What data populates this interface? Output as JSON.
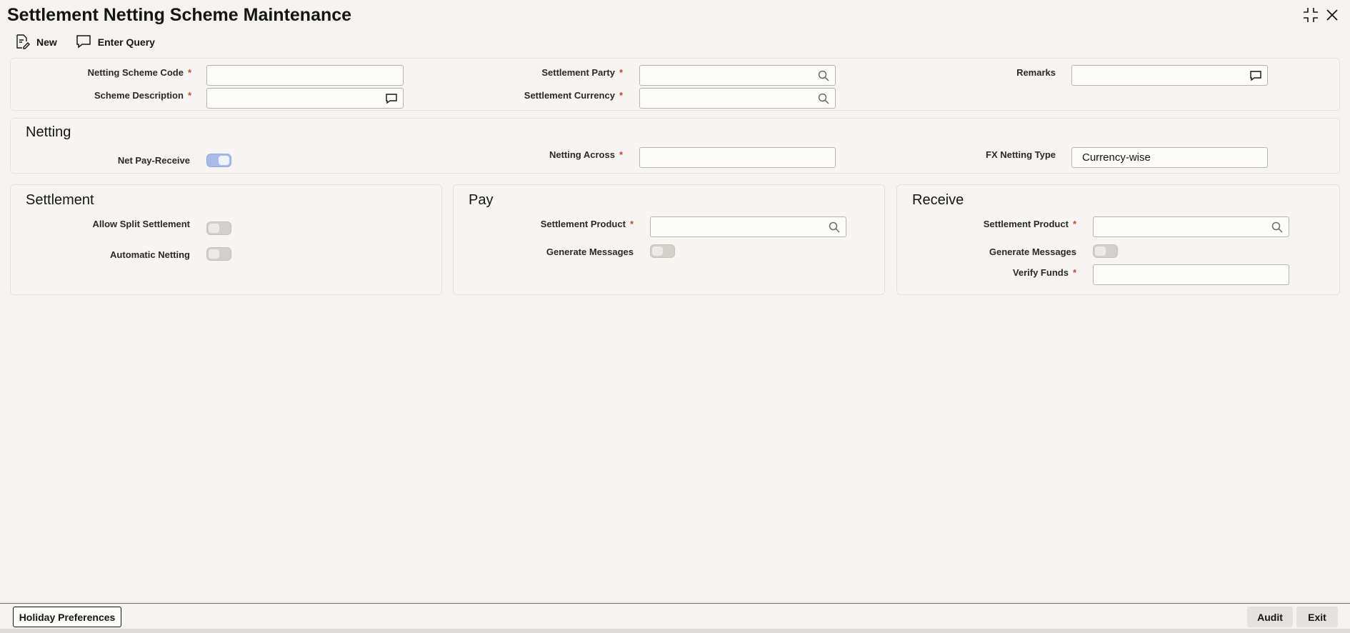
{
  "header": {
    "title": "Settlement Netting Scheme Maintenance"
  },
  "window_controls": [
    {
      "icon": "collapse-icon"
    },
    {
      "icon": "close-icon"
    }
  ],
  "toolbar": {
    "new_label": "New",
    "new_icon": "new-document-icon",
    "enter_query_label": "Enter Query",
    "enter_query_icon": "chat-bubble-icon"
  },
  "main_form": {
    "netting_scheme_code": {
      "label": "Netting Scheme Code",
      "required": "*",
      "value": ""
    },
    "scheme_description": {
      "label": "Scheme Description",
      "required": "*",
      "value": "",
      "icon": "chat-bubble-icon"
    },
    "settlement_party": {
      "label": "Settlement Party",
      "required": "*",
      "value": "",
      "icon": "search-icon"
    },
    "settlement_currency": {
      "label": "Settlement Currency",
      "required": "*",
      "value": "",
      "icon": "search-icon"
    },
    "remarks": {
      "label": "Remarks",
      "value": "",
      "icon": "chat-bubble-icon"
    }
  },
  "netting": {
    "title": "Netting",
    "net_pay_receive": {
      "label": "Net Pay-Receive",
      "checked": true
    },
    "netting_across": {
      "label": "Netting Across",
      "required": "*",
      "value": ""
    },
    "fx_netting_type": {
      "label": "FX Netting Type",
      "value": "Currency-wise"
    }
  },
  "settlement": {
    "title": "Settlement",
    "allow_split_settlement": {
      "label": "Allow Split Settlement",
      "checked": false
    },
    "automatic_netting": {
      "label": "Automatic Netting",
      "checked": false
    }
  },
  "pay": {
    "title": "Pay",
    "settlement_product": {
      "label": "Settlement Product",
      "required": "*",
      "value": "",
      "icon": "search-icon"
    },
    "generate_messages": {
      "label": "Generate Messages",
      "checked": false
    }
  },
  "receive": {
    "title": "Receive",
    "settlement_product": {
      "label": "Settlement Product",
      "required": "*",
      "value": "",
      "icon": "search-icon"
    },
    "generate_messages": {
      "label": "Generate Messages",
      "checked": false
    },
    "verify_funds": {
      "label": "Verify Funds",
      "required": "*",
      "value": ""
    }
  },
  "footer": {
    "holiday_preferences_label": "Holiday Preferences",
    "audit_label": "Audit",
    "exit_label": "Exit"
  },
  "colors": {
    "required_marker": "#c74634",
    "toggle_on": "#a9bbe8",
    "toggle_off": "#d3d0cb"
  }
}
